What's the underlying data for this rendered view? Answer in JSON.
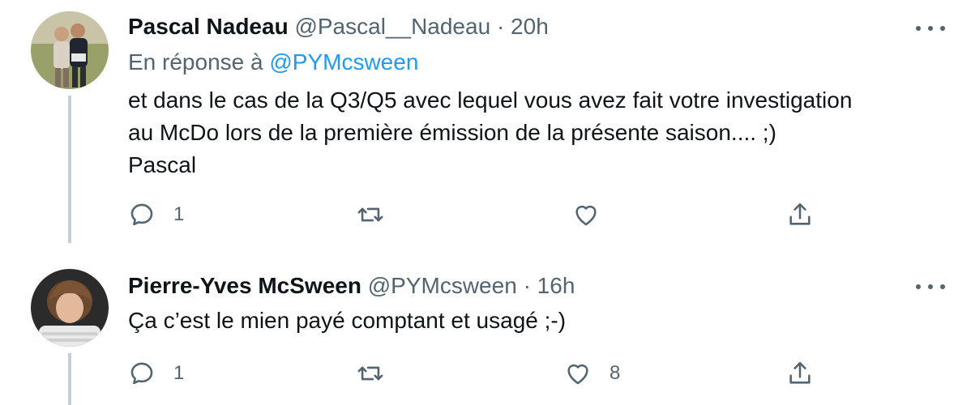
{
  "tweets": [
    {
      "name": "Pascal Nadeau",
      "handle": "@Pascal__Nadeau",
      "separator": "·",
      "time": "20h",
      "reply_prefix": "En réponse à",
      "reply_to": "@PYMcsween",
      "lines": [
        "et dans le cas de la Q3/Q5 avec lequel vous avez fait votre investigation",
        "au McDo lors de la première émission de la présente saison.... ;)",
        "Pascal"
      ],
      "reply_count": "1",
      "retweet_count": "",
      "like_count": ""
    },
    {
      "name": "Pierre-Yves McSween",
      "handle": "@PYMcsween",
      "separator": "·",
      "time": "16h",
      "lines": [
        "Ça c’est le mien payé comptant et usagé ;-)"
      ],
      "reply_count": "1",
      "retweet_count": "",
      "like_count": "8"
    }
  ],
  "colors": {
    "text": "#0f1419",
    "secondary": "#536471",
    "link": "#1d9bf0",
    "thread_line": "#c4cfd6"
  },
  "icons": [
    "reply-icon",
    "retweet-icon",
    "like-icon",
    "share-icon",
    "more-icon"
  ]
}
